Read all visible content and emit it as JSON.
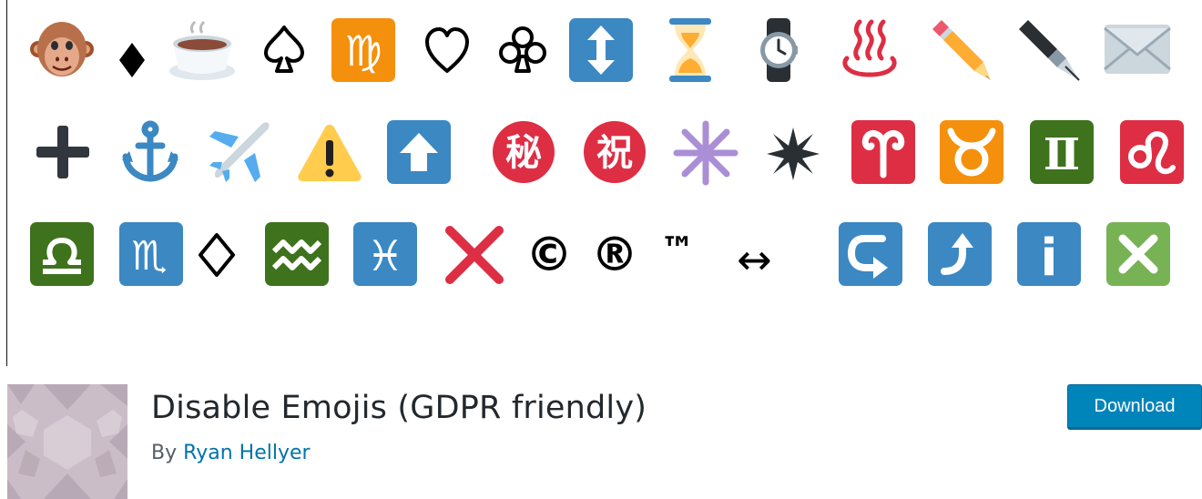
{
  "banner": {
    "emojis": [
      "monkey-face",
      "black-diamond-suit",
      "hot-beverage",
      "black-spade-suit",
      "virgo",
      "white-heart-suit",
      "white-club-suit",
      "up-down-arrow",
      "hourglass",
      "watch",
      "hot-springs",
      "pencil",
      "fountain-pen-nib",
      "envelope",
      "heavy-plus",
      "anchor",
      "airplane",
      "warning",
      "up-arrow",
      "ideograph-secret",
      "ideograph-congratulation",
      "eight-spoked-asterisk",
      "eight-pointed-star",
      "aries",
      "taurus",
      "gemini",
      "leo",
      "libra",
      "scorpius",
      "white-diamond-suit",
      "aquarius",
      "pisces",
      "cross-mark",
      "copyright",
      "registered",
      "trade-mark",
      "left-right-arrow",
      "leftwards-arrow-with-hook",
      "arrow-curving-up",
      "information-source",
      "negative-squared-cross-mark"
    ],
    "texts": {
      "virgo": "♍",
      "secret": "秘",
      "congratulation": "祝",
      "gemini": "Ⅱ",
      "scorpius": "♏",
      "pisces": "♓",
      "copyright": "©",
      "registered": "®",
      "trade_mark": "™",
      "left_right_arrow": "↔",
      "info": "i"
    },
    "colors": {
      "orange": "#f4900c",
      "blue": "#3b88c3",
      "red": "#dd2e44",
      "green": "#3e721d",
      "light_green": "#77b255",
      "purple": "#aa8ed6",
      "gold": "#ffac33",
      "dark": "#292f33",
      "warning_yellow": "#ffcc4d"
    }
  },
  "plugin": {
    "title": "Disable Emojis (GDPR friendly)",
    "by_label": "By",
    "author": "Ryan Hellyer",
    "download_label": "Download"
  }
}
